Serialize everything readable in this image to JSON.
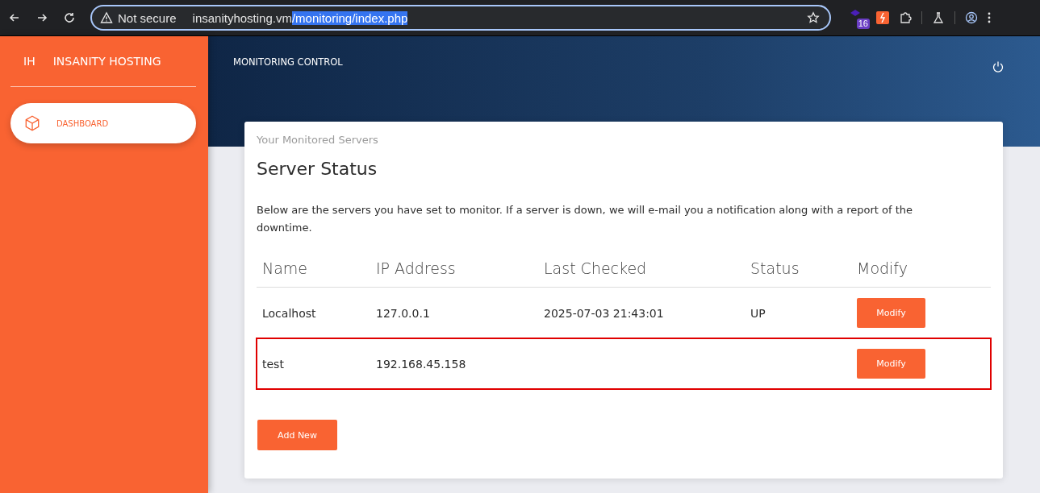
{
  "browser": {
    "security_label": "Not secure",
    "url_parts": [
      {
        "text": "insanityhosting.vm",
        "selected": false
      },
      {
        "text": "/monitoring/index.php",
        "selected": true
      }
    ],
    "extension_badge": "16"
  },
  "sidebar": {
    "logo_mini": "IH",
    "logo_text": "INSANITY HOSTING",
    "items": [
      {
        "label": "DASHBOARD",
        "selected": true
      }
    ]
  },
  "header": {
    "title": "MONITORING CONTROL"
  },
  "card": {
    "category": "Your Monitored Servers",
    "title": "Server Status",
    "description": "Below are the servers you have set to monitor. If a server is down, we will e-mail you a notification along with a report of the downtime.",
    "table": {
      "columns": [
        "Name",
        "IP Address",
        "Last Checked",
        "Status",
        "Modify"
      ],
      "rows": [
        {
          "name": "Localhost",
          "ip": "127.0.0.1",
          "last_checked": "2025-07-03 21:43:01",
          "status": "UP",
          "action": "Modify",
          "highlighted": false
        },
        {
          "name": "test",
          "ip": "192.168.45.158",
          "action": "Modify",
          "highlighted": true
        }
      ]
    },
    "add_button": "Add New"
  }
}
